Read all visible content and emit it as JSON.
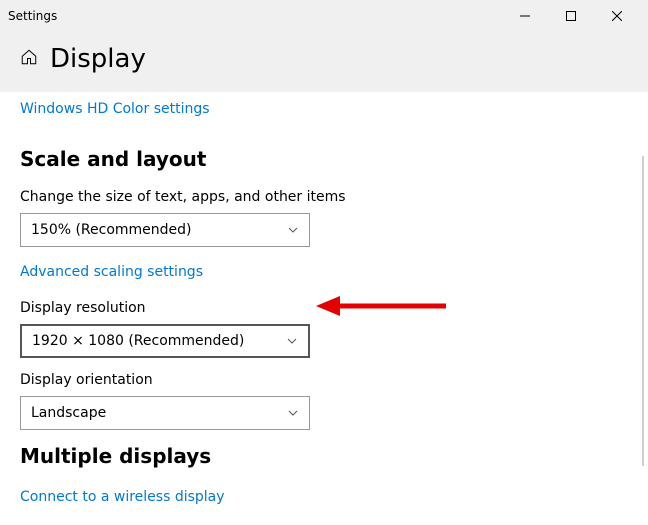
{
  "titlebar": {
    "title": "Settings"
  },
  "header": {
    "title": "Display"
  },
  "links": {
    "hd_color": "Windows HD Color settings",
    "advanced_scaling": "Advanced scaling settings",
    "wireless_display": "Connect to a wireless display"
  },
  "sections": {
    "scale_layout": "Scale and layout",
    "multiple_displays": "Multiple displays"
  },
  "fields": {
    "scale": {
      "label": "Change the size of text, apps, and other items",
      "value": "150% (Recommended)"
    },
    "resolution": {
      "label": "Display resolution",
      "value": "1920 × 1080 (Recommended)"
    },
    "orientation": {
      "label": "Display orientation",
      "value": "Landscape"
    }
  }
}
